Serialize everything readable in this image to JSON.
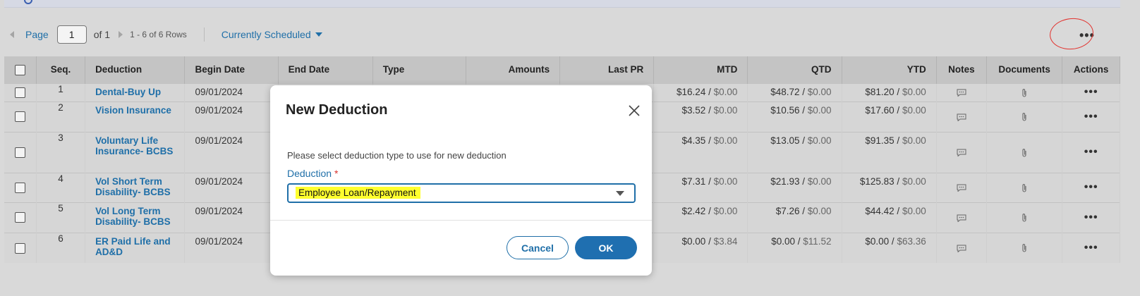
{
  "pager": {
    "page_label": "Page",
    "page_value": "1",
    "of_label": "of 1",
    "rows_label": "1 - 6 of 6 Rows",
    "filter_label": "Currently Scheduled"
  },
  "more_label": "•••",
  "table": {
    "headers": [
      "Seq.",
      "Deduction",
      "Begin Date",
      "End Date",
      "Type",
      "Amounts",
      "Last PR",
      "MTD",
      "QTD",
      "YTD",
      "Notes",
      "Documents",
      "Actions"
    ],
    "rows": [
      {
        "seq": "1",
        "deduction": "Dental-Buy Up",
        "begin": "09/01/2024",
        "mtd_a": "$16.24",
        "mtd_b": "$0.00",
        "qtd_a": "$48.72",
        "qtd_b": "$0.00",
        "ytd_a": "$81.20",
        "ytd_b": "$0.00"
      },
      {
        "seq": "2",
        "deduction": "Vision Insurance",
        "begin": "09/01/2024",
        "mtd_a": "$3.52",
        "mtd_b": "$0.00",
        "qtd_a": "$10.56",
        "qtd_b": "$0.00",
        "ytd_a": "$17.60",
        "ytd_b": "$0.00"
      },
      {
        "seq": "3",
        "deduction": "Voluntary Life Insurance- BCBS",
        "begin": "09/01/2024",
        "mtd_a": "$4.35",
        "mtd_b": "$0.00",
        "qtd_a": "$13.05",
        "qtd_b": "$0.00",
        "ytd_a": "$91.35",
        "ytd_b": "$0.00"
      },
      {
        "seq": "4",
        "deduction": "Vol Short Term Disability- BCBS",
        "begin": "09/01/2024",
        "mtd_a": "$7.31",
        "mtd_b": "$0.00",
        "qtd_a": "$21.93",
        "qtd_b": "$0.00",
        "ytd_a": "$125.83",
        "ytd_b": "$0.00"
      },
      {
        "seq": "5",
        "deduction": "Vol Long Term Disability- BCBS",
        "begin": "09/01/2024",
        "mtd_a": "$2.42",
        "mtd_b": "$0.00",
        "qtd_a": "$7.26",
        "qtd_b": "$0.00",
        "ytd_a": "$44.42",
        "ytd_b": "$0.00"
      },
      {
        "seq": "6",
        "deduction": "ER Paid Life and AD&D",
        "begin": "09/01/2024",
        "mtd_a": "$0.00",
        "mtd_b": "$3.84",
        "qtd_a": "$0.00",
        "qtd_b": "$11.52",
        "ytd_a": "$0.00",
        "ytd_b": "$63.36"
      }
    ]
  },
  "modal": {
    "title": "New Deduction",
    "description": "Please select deduction type to use for new deduction",
    "field_label": "Deduction",
    "required_mark": "*",
    "selected_value": "Employee Loan/Repayment",
    "cancel_label": "Cancel",
    "ok_label": "OK"
  },
  "colors": {
    "accent": "#1f6fa8",
    "highlight": "#ffff2e",
    "annotation": "#e2322e"
  }
}
